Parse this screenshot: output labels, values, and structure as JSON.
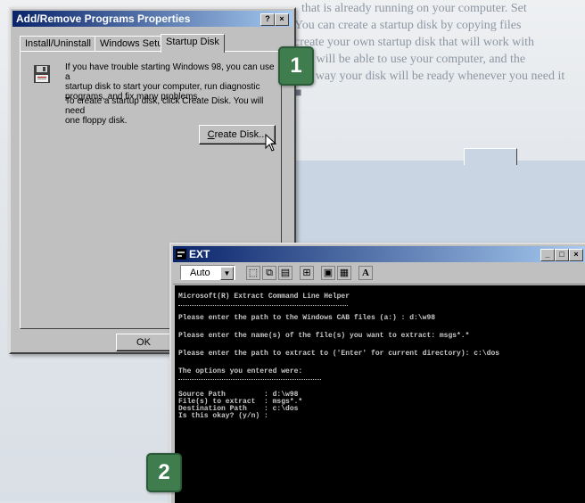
{
  "page_text": {
    "lines": [
      "that is already running on your computer. Set",
      "You can create a startup disk by copying files",
      "create your own startup disk that will work with",
      "you will be able to use your computer, and the",
      "this way your disk will be ready whenever you need it"
    ],
    "end_glyph": "■"
  },
  "dialog": {
    "title": "Add/Remove Programs Properties",
    "help_button": "?",
    "close_button": "×",
    "tabs": [
      "Install/Uninstall",
      "Windows Setup",
      "Startup Disk"
    ],
    "active_tab": "Startup Disk",
    "text1": [
      "If you have trouble starting Windows 98, you can use a",
      "startup disk to start your computer, run diagnostic",
      "programs, and fix many problems."
    ],
    "text2": [
      "To create a startup disk, click Create Disk. You will need",
      "one floppy disk."
    ],
    "create_disk_button": {
      "mnemonic": "C",
      "rest": "reate Disk..."
    },
    "ok_button": "OK",
    "cancel_button_partial": "C"
  },
  "ext_window": {
    "title": "EXT",
    "controls": [
      "_",
      "□",
      "×"
    ],
    "font_size_value": "Auto",
    "toolbar_letter": "A",
    "lines": [
      "Microsoft(R) Extract Command Line Helper",
      "Please enter the path to the Windows CAB files (a:) : d:\\w98",
      "Please enter the name(s) of the file(s) you want to extract: msgs*.*",
      "Please enter the path to extract to ('Enter' for current directory): c:\\dos",
      "The options you entered were:",
      "Source Path         : d:\\w98",
      "File(s) to extract  : msgs*.*",
      "Destination Path    : c:\\dos",
      "Is this okay? (y/n) :"
    ]
  },
  "badges": {
    "step1": "1",
    "step2": "2"
  },
  "colors": {
    "titlebar_start": "#0a246a",
    "titlebar_end": "#a6caf0",
    "badge_green": "#3f7d4f",
    "console_bg": "#000000",
    "window_face": "#c0c0c0"
  }
}
